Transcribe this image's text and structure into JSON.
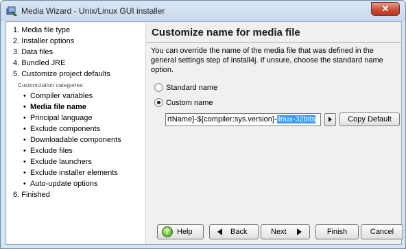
{
  "window": {
    "title": "Media Wizard - Unix/Linux GUI installer",
    "close_label": "✕"
  },
  "steps": {
    "items": [
      "1. Media file type",
      "2. Installer options",
      "3. Data files",
      "4. Bundled JRE",
      "5. Customize project defaults"
    ],
    "categories_header": "Customization categories:",
    "sub_items": [
      {
        "label": "Compiler variables",
        "active": false
      },
      {
        "label": "Media file name",
        "active": true
      },
      {
        "label": "Principal language",
        "active": false
      },
      {
        "label": "Exclude components",
        "active": false
      },
      {
        "label": "Downloadable components",
        "active": false
      },
      {
        "label": "Exclude files",
        "active": false
      },
      {
        "label": "Exclude launchers",
        "active": false
      },
      {
        "label": "Exclude installer elements",
        "active": false
      },
      {
        "label": "Auto-update options",
        "active": false
      }
    ],
    "final": "6. Finished"
  },
  "main": {
    "heading": "Customize name for media file",
    "description": "You can override the name of the media file that was defined in the general settings step of install4j. If unsure, choose the standard name option.",
    "options": [
      {
        "label": "Standard name",
        "checked": false
      },
      {
        "label": "Custom name",
        "checked": true
      }
    ],
    "name_field": {
      "value_unselected": "rtName}-${compiler:sys.version}-",
      "value_selected": "linux-32bits"
    },
    "copy_default_label": "Copy Default"
  },
  "buttons": {
    "help": "Help",
    "back": "Back",
    "next": "Next",
    "finish": "Finish",
    "cancel": "Cancel"
  },
  "colors": {
    "selection": "#3399ff",
    "title_bar": "#c9d9ec",
    "close_button": "#c94f38"
  },
  "icons": [
    "app-icon",
    "close-icon",
    "help-icon",
    "back-arrow-icon",
    "next-arrow-icon",
    "variable-menu-icon"
  ]
}
